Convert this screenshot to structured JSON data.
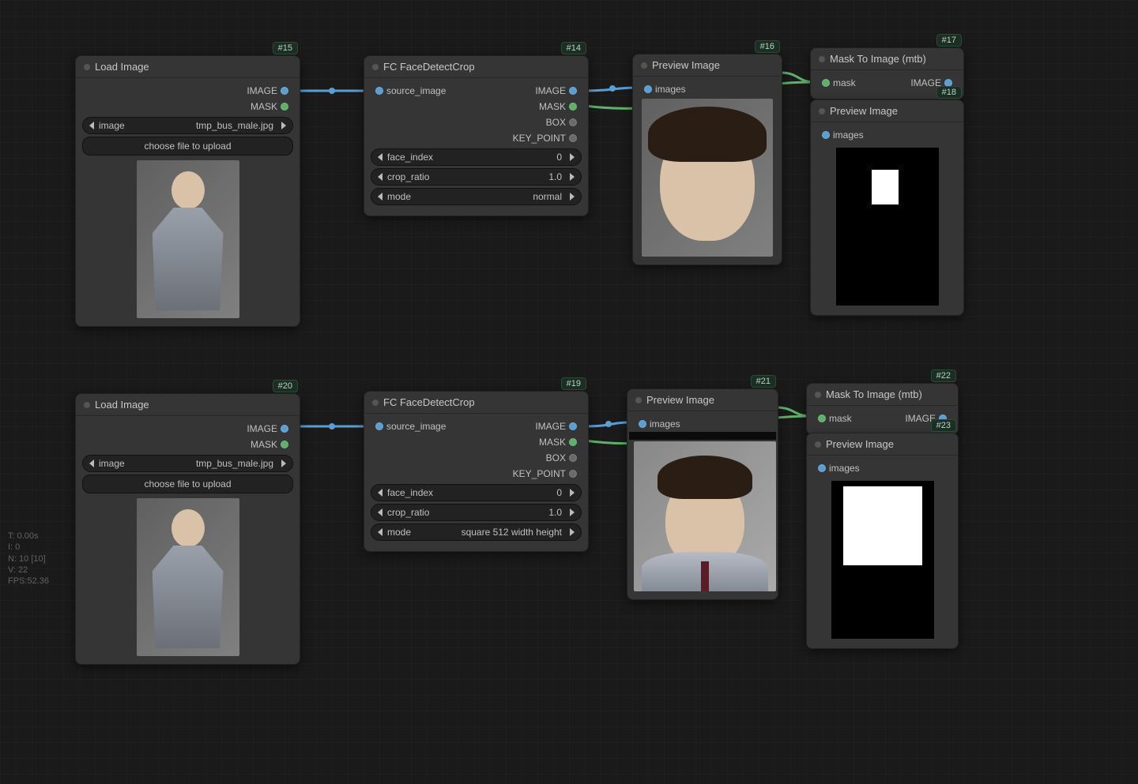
{
  "stats": {
    "t": "T: 0.00s",
    "i": "I: 0",
    "n": "N: 10 [10]",
    "v": "V: 22",
    "fps": "FPS:52.36"
  },
  "nodes": {
    "n15": {
      "badge": "#15",
      "title": "Load Image",
      "out_image": "IMAGE",
      "out_mask": "MASK",
      "widget_image_name": "image",
      "widget_image_val": "tmp_bus_male.jpg",
      "upload": "choose file to upload"
    },
    "n14": {
      "badge": "#14",
      "title": "FC FaceDetectCrop",
      "in": "source_image",
      "out_image": "IMAGE",
      "out_mask": "MASK",
      "out_box": "BOX",
      "out_kp": "KEY_POINT",
      "w1n": "face_index",
      "w1v": "0",
      "w2n": "crop_ratio",
      "w2v": "1.0",
      "w3n": "mode",
      "w3v": "normal"
    },
    "n16": {
      "badge": "#16",
      "title": "Preview Image",
      "in": "images"
    },
    "n17": {
      "badge": "#17",
      "title": "Mask To Image (mtb)",
      "in": "mask",
      "out": "IMAGE"
    },
    "n18": {
      "badge": "#18",
      "title": "Preview Image",
      "in": "images"
    },
    "n20": {
      "badge": "#20",
      "title": "Load Image",
      "out_image": "IMAGE",
      "out_mask": "MASK",
      "widget_image_name": "image",
      "widget_image_val": "tmp_bus_male.jpg",
      "upload": "choose file to upload"
    },
    "n19": {
      "badge": "#19",
      "title": "FC FaceDetectCrop",
      "in": "source_image",
      "out_image": "IMAGE",
      "out_mask": "MASK",
      "out_box": "BOX",
      "out_kp": "KEY_POINT",
      "w1n": "face_index",
      "w1v": "0",
      "w2n": "crop_ratio",
      "w2v": "1.0",
      "w3n": "mode",
      "w3v": "square 512 width height"
    },
    "n21": {
      "badge": "#21",
      "title": "Preview Image",
      "in": "images"
    },
    "n22": {
      "badge": "#22",
      "title": "Mask To Image (mtb)",
      "in": "mask",
      "out": "IMAGE"
    },
    "n23": {
      "badge": "#23",
      "title": "Preview Image",
      "in": "images"
    }
  }
}
